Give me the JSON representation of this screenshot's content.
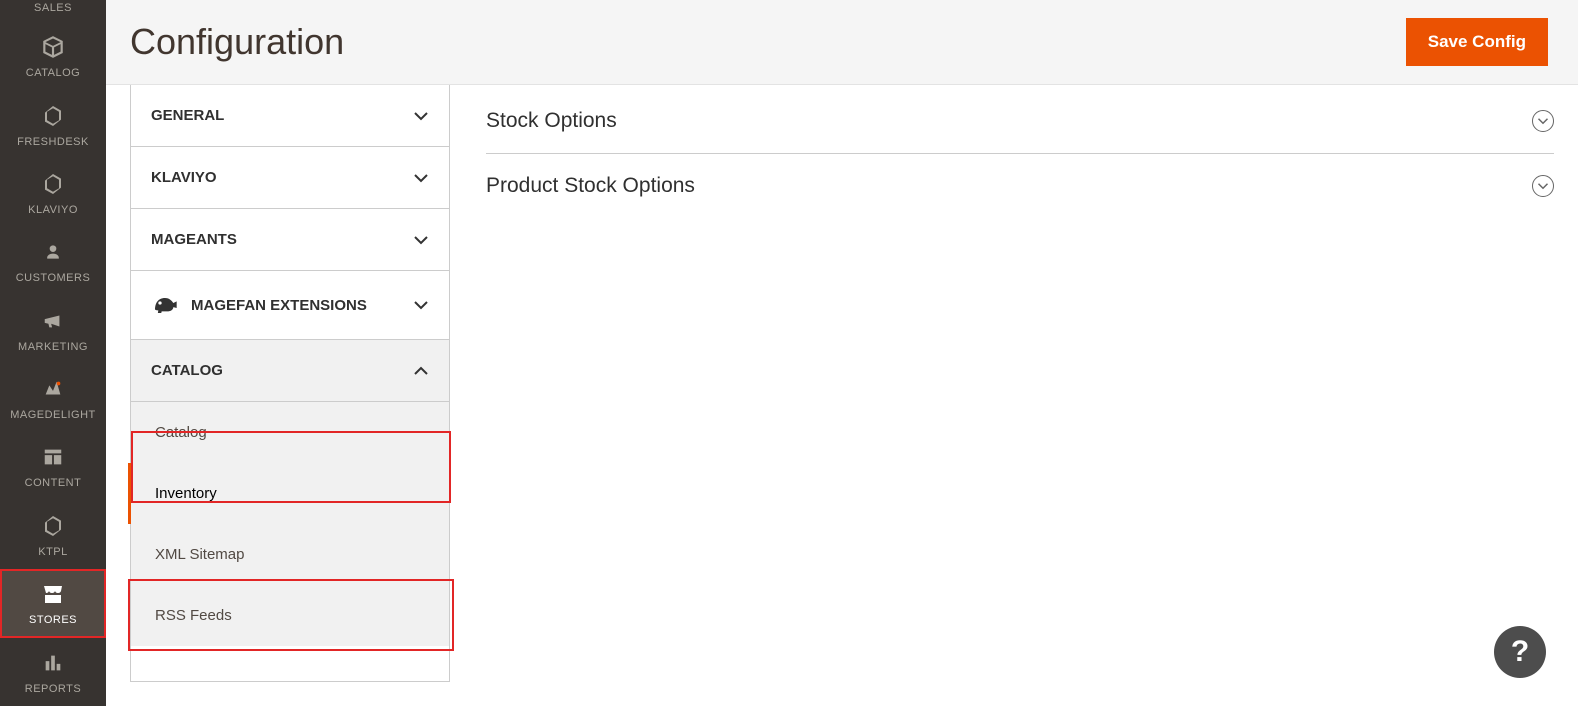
{
  "nav": {
    "items": [
      {
        "key": "sales",
        "label": "SALES"
      },
      {
        "key": "catalog",
        "label": "CATALOG"
      },
      {
        "key": "freshdesk",
        "label": "FRESHDESK"
      },
      {
        "key": "klaviyo",
        "label": "KLAVIYO"
      },
      {
        "key": "customers",
        "label": "CUSTOMERS"
      },
      {
        "key": "marketing",
        "label": "MARKETING"
      },
      {
        "key": "magedelight",
        "label": "MAGEDELIGHT"
      },
      {
        "key": "content",
        "label": "CONTENT"
      },
      {
        "key": "ktpl",
        "label": "KTPL"
      },
      {
        "key": "stores",
        "label": "STORES",
        "active": true
      },
      {
        "key": "reports",
        "label": "REPORTS"
      }
    ]
  },
  "header": {
    "title": "Configuration",
    "save_label": "Save Config"
  },
  "config_sidebar": {
    "sections": [
      {
        "label": "GENERAL"
      },
      {
        "label": "KLAVIYO"
      },
      {
        "label": "MAGEANTS"
      },
      {
        "label": "MAGEFAN EXTENSIONS",
        "has_icon": true
      },
      {
        "label": "CATALOG",
        "open": true,
        "children": [
          {
            "label": "Catalog"
          },
          {
            "label": "Inventory",
            "active": true
          },
          {
            "label": "XML Sitemap"
          },
          {
            "label": "RSS Feeds"
          }
        ]
      }
    ]
  },
  "content": {
    "sections": [
      {
        "label": "Stock Options"
      },
      {
        "label": "Product Stock Options"
      }
    ]
  },
  "help_fab": "?"
}
